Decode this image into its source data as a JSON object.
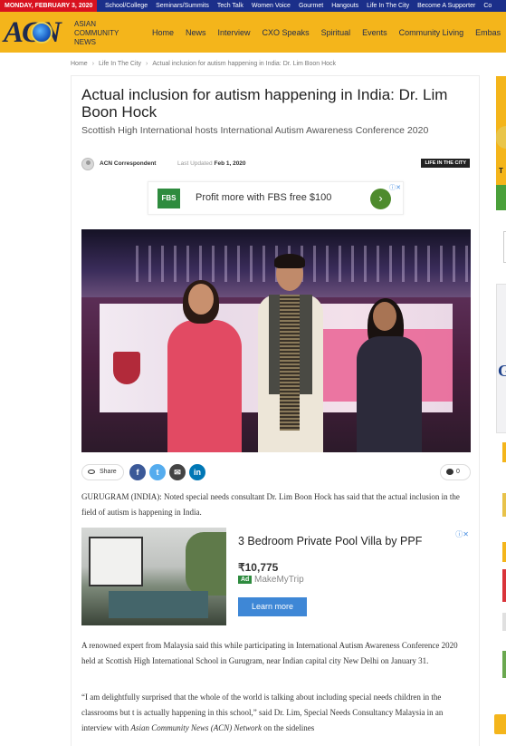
{
  "topbar": {
    "date": "MONDAY, FEBRUARY 3, 2020",
    "links": [
      "School/College",
      "Seminars/Summits",
      "Tech Talk",
      "Women Voice",
      "Gourmet",
      "Hangouts",
      "Life In The City",
      "Become A Supporter",
      "Co"
    ]
  },
  "header": {
    "logo_text": "ACN",
    "logo_sub_1": "ASIAN",
    "logo_sub_2": "COMMUNITY",
    "logo_sub_3": "NEWS",
    "nav": [
      "Home",
      "News",
      "Interview",
      "CXO Speaks",
      "Spiritual",
      "Events",
      "Community Living",
      "Embas"
    ]
  },
  "breadcrumb": {
    "items": [
      "Home",
      "Life In The City",
      "Actual inclusion for autism happening in India:  Dr. Lim Boon Hock"
    ]
  },
  "article": {
    "title": "Actual inclusion for autism happening in India:  Dr. Lim Boon Hock",
    "subtitle": "Scottish High International hosts International Autism Awareness Conference 2020",
    "author": "ACN Correspondent",
    "updated_label": "Last Updated",
    "updated_date": "Feb 1, 2020",
    "category": "LIFE IN THE CITY",
    "share_label": "Share",
    "comments_count": "0",
    "paragraphs": [
      "GURUGRAM (INDIA): Noted special needs consultant Dr. Lim Boon Hock has said that the actual inclusion in the field of autism is happening in India.",
      "A renowned expert from Malaysia said this while participating in International Autism Awareness Conference 2020 held at Scottish High International School in Gurugram, near Indian capital city New Delhi on January 31.",
      "“I am delightfully surprised that the whole of the world is talking about including special needs children in the classrooms but t is actually happening in this school,” said Dr. Lim, Special Needs Consultancy Malaysia in an interview with ",
      "Asian Community News (ACN) Network",
      " on the sidelines"
    ]
  },
  "ad_small": {
    "logo": "FBS",
    "text": "Profit more with FBS free $100",
    "cta_icon": "›"
  },
  "ad_large": {
    "headline": "3 Bedroom Private Pool Villa by PPF",
    "price": "₹10,775",
    "ad_tag": "Ad",
    "source": "MakeMyTrip",
    "cta": "Learn more"
  },
  "social": {
    "icons": [
      "facebook-icon",
      "twitter-icon",
      "email-icon",
      "linkedin-icon"
    ],
    "colors": {
      "facebook": "#3b5998",
      "twitter": "#55acee",
      "email": "#444444",
      "linkedin": "#0077b5"
    }
  },
  "rail": {
    "letter_1": "T",
    "letter_2": "G"
  },
  "colors": {
    "topbar": "#1b2f8a",
    "date_badge": "#d8121f",
    "header": "#f4b51b",
    "brand_dark": "#1e2a4f"
  }
}
